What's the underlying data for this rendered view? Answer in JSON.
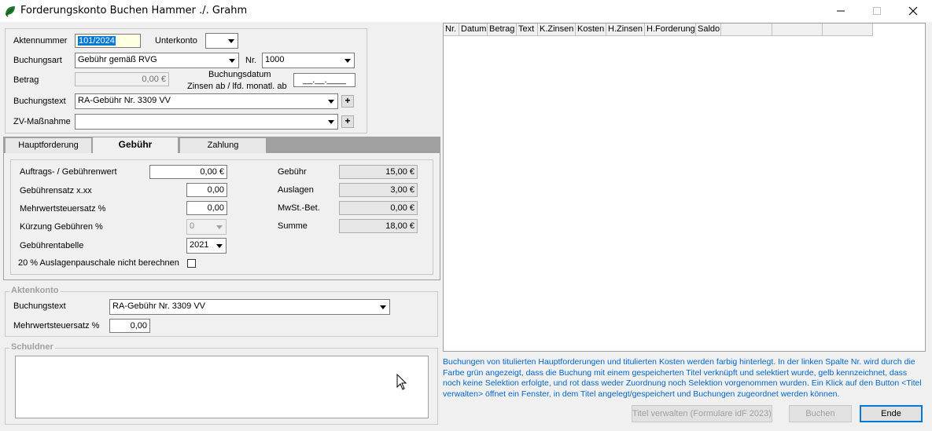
{
  "window": {
    "title": "Forderungskonto Buchen Hammer ./. Grahm",
    "minimize_icon": "minimize-icon",
    "maximize_icon": "maximize-icon",
    "close_icon": "close-icon"
  },
  "form": {
    "aktennummer_label": "Aktennummer",
    "aktennummer_value": "101/2024",
    "unterkonto_label": "Unterkonto",
    "unterkonto_value": "",
    "buchungsart_label": "Buchungsart",
    "buchungsart_value": "Gebühr gemäß RVG",
    "nr_label": "Nr.",
    "nr_value": "1000",
    "betrag_label": "Betrag",
    "betrag_value": "0,00 €",
    "buchungsdatum_label_line1": "Buchungsdatum",
    "buchungsdatum_label_line2": "Zinsen ab / lfd. monatl. ab",
    "buchungsdatum_value": "__.__.____",
    "buchungstext_label": "Buchungstext",
    "buchungstext_value": "RA-Gebühr Nr. 3309 VV",
    "zv_label": "ZV-Maßnahme",
    "zv_value": "",
    "plus_label": "+"
  },
  "tabs": [
    {
      "label": "Hauptforderung"
    },
    {
      "label": "Gebühr"
    },
    {
      "label": "Zahlung"
    }
  ],
  "gebuehr": {
    "auftragswert_label": "Auftrags- / Gebührenwert",
    "auftragswert_value": "0,00 €",
    "gebuehrensatz_label": "Gebührensatz x.xx",
    "gebuehrensatz_value": "0,00",
    "mwst_satz_label": "Mehrwertsteuersatz %",
    "mwst_satz_value": "0,00",
    "kuerzung_label": "Kürzung Gebühren %",
    "kuerzung_value": "0",
    "tabelle_label": "Gebührentabelle",
    "tabelle_value": "2021",
    "pauschale_label": "20 % Auslagenpauschale nicht berechnen",
    "pauschale_checked": false,
    "gebuehr_label": "Gebühr",
    "gebuehr_value": "15,00 €",
    "auslagen_label": "Auslagen",
    "auslagen_value": "3,00 €",
    "mwst_bet_label": "MwSt.-Bet.",
    "mwst_bet_value": "0,00 €",
    "summe_label": "Summe",
    "summe_value": "18,00 €"
  },
  "aktenkonto": {
    "legend": "Aktenkonto",
    "buchungstext_label": "Buchungstext",
    "buchungstext_value": "RA-Gebühr Nr. 3309 VV",
    "mwst_label": "Mehrwertsteuersatz %",
    "mwst_value": "0,00"
  },
  "schuldner": {
    "legend": "Schuldner",
    "text": ""
  },
  "grid": {
    "columns": [
      "Nr.",
      "Datum",
      "Betrag",
      "Text",
      "K.Zinsen",
      "Kosten",
      "H.Zinsen",
      "H.Forderung",
      "Saldo",
      "",
      ""
    ],
    "rows": []
  },
  "info_text": "Buchungen von titulierten Hauptforderungen und titulierten Kosten werden farbig hinterlegt. In der linken Spalte Nr. wird durch die Farbe grün angezeigt, dass die Buchung mit einem gespeicherten Titel verknüpft und selektiert wurde, gelb kennzeichnet, dass noch keine Selektion erfolgte, und rot dass weder Zuordnung noch Selektion vorgenommen wurden. Ein Klick auf den Button <Titel verwalten> öffnet ein Fenster, in dem Titel angelegt/gespeichert und Buchungen zugeordnet werden können.",
  "buttons": {
    "titel_verwalten": "Titel verwalten (Formulare idF 2023)",
    "buchen": "Buchen",
    "ende": "Ende"
  },
  "colors": {
    "selection": "#0078d7",
    "info_text": "#0066cc"
  }
}
